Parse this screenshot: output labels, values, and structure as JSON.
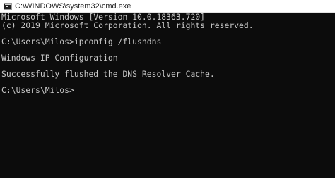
{
  "window": {
    "title": "C:\\WINDOWS\\system32\\cmd.exe",
    "app_icon": "cmd-console-icon"
  },
  "console": {
    "lines": [
      "Microsoft Windows [Version 10.0.18363.720]",
      "(c) 2019 Microsoft Corporation. All rights reserved.",
      "",
      "C:\\Users\\Milos>ipconfig /flushdns",
      "",
      "Windows IP Configuration",
      "",
      "Successfully flushed the DNS Resolver Cache.",
      "",
      "C:\\Users\\Milos>"
    ]
  },
  "colors": {
    "background": "#0c0c0c",
    "text": "#c8c8c8",
    "titlebar": "#ffffff"
  }
}
